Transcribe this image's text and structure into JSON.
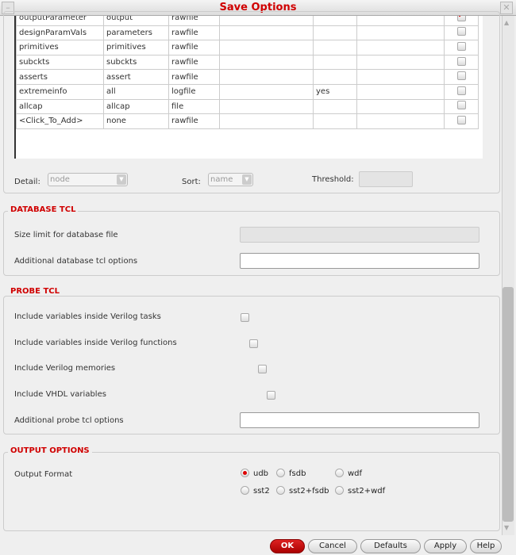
{
  "window": {
    "title": "Save Options"
  },
  "table": {
    "rows": [
      {
        "name": "outputParameter",
        "type": "output",
        "dest": "rawfile",
        "c4": "",
        "c5": "",
        "c6": "",
        "checked": true
      },
      {
        "name": "designParamVals",
        "type": "parameters",
        "dest": "rawfile",
        "c4": "",
        "c5": "",
        "c6": "",
        "checked": false
      },
      {
        "name": "primitives",
        "type": "primitives",
        "dest": "rawfile",
        "c4": "",
        "c5": "",
        "c6": "",
        "checked": false
      },
      {
        "name": "subckts",
        "type": "subckts",
        "dest": "rawfile",
        "c4": "",
        "c5": "",
        "c6": "",
        "checked": false
      },
      {
        "name": "asserts",
        "type": "assert",
        "dest": "rawfile",
        "c4": "",
        "c5": "",
        "c6": "",
        "checked": false
      },
      {
        "name": "extremeinfo",
        "type": "all",
        "dest": "logfile",
        "c4": "",
        "c5": "yes",
        "c6": "",
        "checked": false
      },
      {
        "name": "allcap",
        "type": "allcap",
        "dest": "file",
        "c4": "",
        "c5": "",
        "c6": "",
        "checked": false
      },
      {
        "name": "<Click_To_Add>",
        "type": "none",
        "dest": "rawfile",
        "c4": "",
        "c5": "",
        "c6": "",
        "checked": false
      }
    ]
  },
  "filters": {
    "detail_label": "Detail:",
    "detail_value": "node",
    "sort_label": "Sort:",
    "sort_value": "name",
    "threshold_label": "Threshold:"
  },
  "database": {
    "title": "DATABASE TCL",
    "size_limit_label": "Size limit for database file",
    "additional_label": "Additional database tcl options"
  },
  "probe": {
    "title": "PROBE TCL",
    "items": [
      "Include variables inside Verilog tasks",
      "Include variables inside Verilog functions",
      "Include Verilog memories",
      "Include VHDL variables"
    ],
    "additional_label": "Additional probe tcl options"
  },
  "output": {
    "title": "OUTPUT OPTIONS",
    "format_label": "Output Format",
    "options": [
      "udb",
      "fsdb",
      "wdf",
      "sst2",
      "sst2+fsdb",
      "sst2+wdf"
    ],
    "selected": "udb"
  },
  "buttons": {
    "ok": "OK",
    "cancel": "Cancel",
    "defaults": "Defaults",
    "apply": "Apply",
    "help": "Help"
  }
}
